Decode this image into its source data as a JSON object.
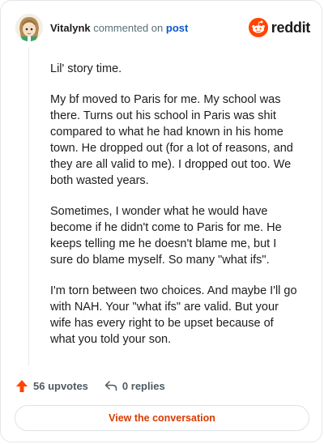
{
  "header": {
    "username": "Vitalynk",
    "commented_on": "commented on",
    "post_link": "post",
    "brand": "reddit"
  },
  "comment": {
    "paragraphs": [
      "Lil' story time.",
      "My bf moved to Paris for me. My school was there. Turns out his school in Paris was shit compared to what he had known in his home town. He dropped out (for a lot of reasons, and they are all valid to me). I dropped out too. We both wasted years.",
      "Sometimes, I wonder what he would have become if he didn't come to Paris for me. He keeps telling me he doesn't blame me, but I sure do blame myself. So many \"what ifs\".",
      "I'm torn between two choices. And maybe I'll go with NAH. Your \"what ifs\" are valid. But your wife has every right to be upset because of what you told your son."
    ]
  },
  "actions": {
    "upvotes": "56 upvotes",
    "replies": "0 replies"
  },
  "cta": {
    "label": "View the conversation"
  },
  "colors": {
    "brand_orange": "#ff4500",
    "link_blue": "#0b58cc",
    "cta_text": "#d93a00"
  },
  "icons": {
    "avatar": "anime-avatar",
    "brand_logo": "reddit-snoo-icon",
    "upvote": "upvote-arrow-icon",
    "reply": "reply-arrow-icon"
  }
}
